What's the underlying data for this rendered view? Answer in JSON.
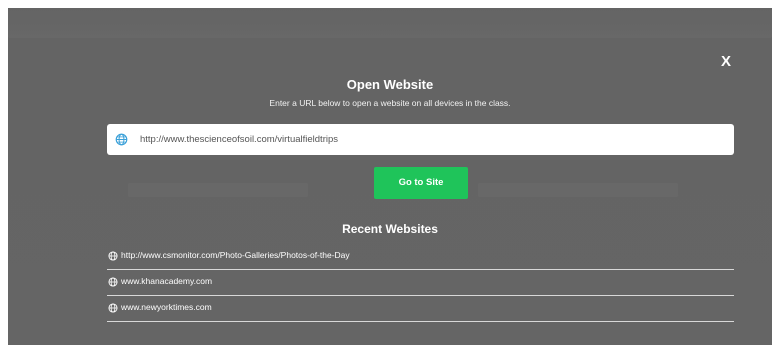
{
  "modal": {
    "close_label": "X",
    "title": "Open Website",
    "subtitle": "Enter a URL below to open a website on all devices in the class.",
    "url_input": {
      "value": "http://www.thescienceofsoil.com/virtualfieldtrips",
      "icon": "globe-icon"
    },
    "go_button_label": "Go to Site",
    "recent": {
      "title": "Recent Websites",
      "items": [
        {
          "label": "http://www.csmonitor.com/Photo-Galleries/Photos-of-the-Day",
          "icon": "globe-icon"
        },
        {
          "label": "www.khanacademy.com",
          "icon": "globe-icon"
        },
        {
          "label": "www.newyorktimes.com",
          "icon": "globe-icon"
        }
      ]
    }
  },
  "colors": {
    "backdrop": "#6a6a6a",
    "go_button": "#1fc45a",
    "url_globe": "#3aa0d8",
    "text": "#ffffff"
  }
}
